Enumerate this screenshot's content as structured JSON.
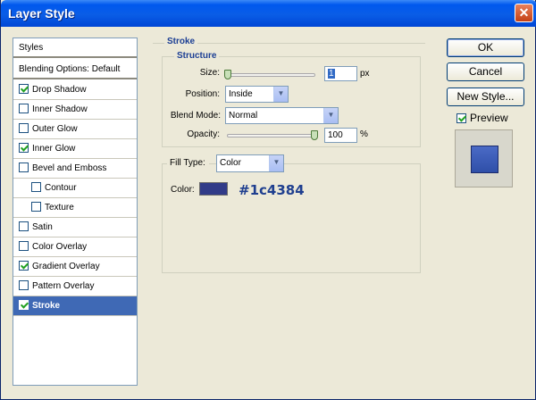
{
  "window": {
    "title": "Layer Style"
  },
  "styles": {
    "header": "Styles",
    "items": [
      {
        "label": "Blending Options: Default",
        "checkbox": false,
        "checked": false,
        "indent": 0
      },
      {
        "label": "Drop Shadow",
        "checkbox": true,
        "checked": true,
        "indent": 0
      },
      {
        "label": "Inner Shadow",
        "checkbox": true,
        "checked": false,
        "indent": 0
      },
      {
        "label": "Outer Glow",
        "checkbox": true,
        "checked": false,
        "indent": 0
      },
      {
        "label": "Inner Glow",
        "checkbox": true,
        "checked": true,
        "indent": 0
      },
      {
        "label": "Bevel and Emboss",
        "checkbox": true,
        "checked": false,
        "indent": 0
      },
      {
        "label": "Contour",
        "checkbox": true,
        "checked": false,
        "indent": 1
      },
      {
        "label": "Texture",
        "checkbox": true,
        "checked": false,
        "indent": 1
      },
      {
        "label": "Satin",
        "checkbox": true,
        "checked": false,
        "indent": 0
      },
      {
        "label": "Color Overlay",
        "checkbox": true,
        "checked": false,
        "indent": 0
      },
      {
        "label": "Gradient Overlay",
        "checkbox": true,
        "checked": true,
        "indent": 0
      },
      {
        "label": "Pattern Overlay",
        "checkbox": true,
        "checked": false,
        "indent": 0
      },
      {
        "label": "Stroke",
        "checkbox": true,
        "checked": true,
        "indent": 0,
        "selected": true
      }
    ]
  },
  "stroke": {
    "title": "Stroke",
    "structure": {
      "title": "Structure",
      "size_label": "Size:",
      "size_value": "1",
      "size_unit": "px",
      "position_label": "Position:",
      "position_value": "Inside",
      "blend_mode_label": "Blend Mode:",
      "blend_mode_value": "Normal",
      "opacity_label": "Opacity:",
      "opacity_value": "100",
      "opacity_unit": "%"
    },
    "fill": {
      "fill_type_label": "Fill Type:",
      "fill_type_value": "Color",
      "color_label": "Color:",
      "color_hex_label": "#1c4384",
      "swatch_color": "#313b88"
    }
  },
  "buttons": {
    "ok": "OK",
    "cancel": "Cancel",
    "new_style": "New Style..."
  },
  "preview": {
    "label": "Preview",
    "checked": true
  }
}
